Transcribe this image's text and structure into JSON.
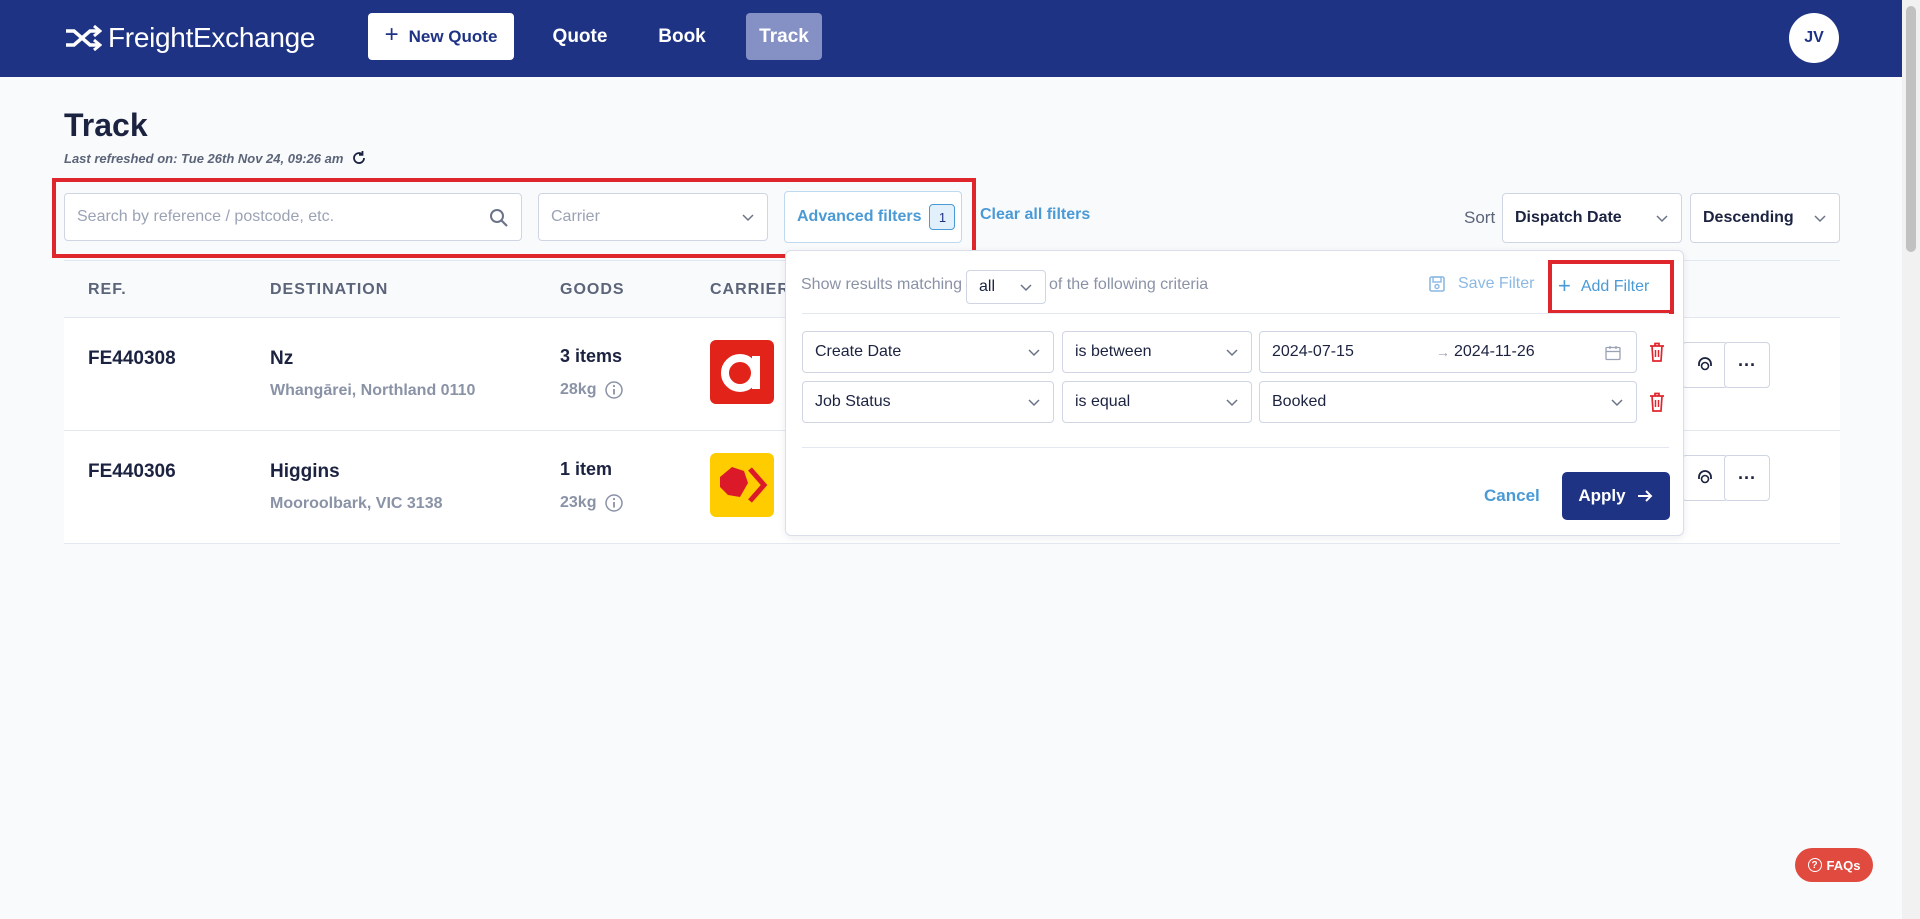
{
  "app": {
    "logo_text": "FreightExchange",
    "accent": "#1f3384",
    "link_color": "#4a9ad6",
    "danger": "#e0262d"
  },
  "nav": {
    "new_quote": "New Quote",
    "items": [
      {
        "label": "Quote"
      },
      {
        "label": "Book"
      },
      {
        "label": "Track",
        "active": true
      }
    ],
    "avatar": "JV"
  },
  "page": {
    "title": "Track",
    "refresh_label": "Last refreshed on:",
    "refresh_time": "Tue 26th Nov 24, 09:26 am"
  },
  "filters": {
    "search_placeholder": "Search by reference / postcode, etc.",
    "carrier_placeholder": "Carrier",
    "advanced_label": "Advanced filters",
    "advanced_count": "1",
    "clear_all": "Clear all filters",
    "sort_label": "Sort",
    "sort_value": "Dispatch Date",
    "order_value": "Descending"
  },
  "table": {
    "headers": [
      "REF.",
      "DESTINATION",
      "GOODS",
      "CARRIER"
    ],
    "rows": [
      {
        "ref": "FE440308",
        "destination": "Nz",
        "address": "Whangārei, Northland 0110",
        "goods": "3 items",
        "weight": "28kg",
        "carrier_icon": "aramex-logo"
      },
      {
        "ref": "FE440306",
        "destination": "Higgins",
        "address": "Mooroolbark, VIC 3138",
        "goods": "1 item",
        "weight": "23kg",
        "carrier_icon": "australia-post-logo"
      }
    ],
    "more_label": "···"
  },
  "advanced_panel": {
    "prefix": "Show results matching",
    "match_value": "all",
    "suffix": "of the following criteria",
    "save_filter": "Save Filter",
    "add_filter": "Add Filter",
    "criteria": [
      {
        "field": "Create Date",
        "operator": "is between",
        "value_start": "2024-07-15",
        "value_end": "2024-11-26"
      },
      {
        "field": "Job Status",
        "operator": "is equal",
        "value": "Booked"
      }
    ],
    "cancel": "Cancel",
    "apply": "Apply"
  },
  "faqs": "FAQs"
}
